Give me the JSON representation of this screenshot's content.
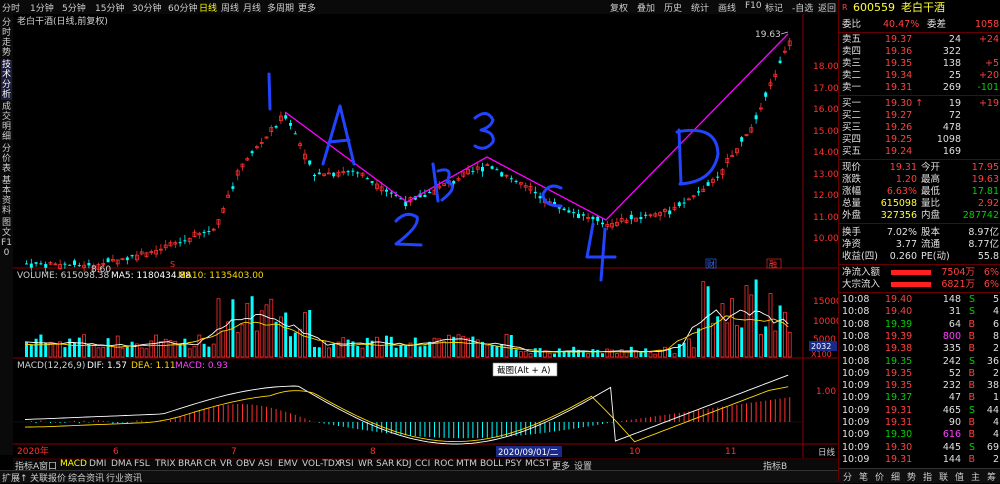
{
  "toolbar": {
    "periods": [
      "分时",
      "1分钟",
      "5分钟",
      "15分钟",
      "30分钟",
      "60分钟",
      "日线",
      "周线",
      "月线",
      "多周期",
      "更多"
    ],
    "active_period": "日线",
    "right_buttons": [
      "复权",
      "叠加",
      "历史",
      "统计",
      "画线",
      "F10",
      "标记",
      "-自选",
      "返回"
    ]
  },
  "left_tabs": [
    "分时走势",
    "技术分析",
    "成交明细",
    "分价表",
    "基本资料",
    "图文F10"
  ],
  "left_tabs_active": "技术分析",
  "chart": {
    "title": "老白干酒(日线,前复权)",
    "price_labels": [
      "18.00",
      "17.00",
      "16.00",
      "15.00",
      "14.00",
      "13.00",
      "12.00",
      "11.00",
      "10.00"
    ],
    "high_label": "19.63",
    "low_label": "8.60",
    "annotations": [
      "1",
      "A",
      "2",
      "B",
      "3",
      "C",
      "4",
      "D"
    ],
    "tags": [
      "财",
      "融"
    ]
  },
  "volume": {
    "header": "VOLUME: 615098.38",
    "ma5": "MA5: 1180434.88",
    "ma10": "MA10: 1135403.00",
    "axis": [
      "15000",
      "10000",
      "5000"
    ],
    "unit": "X100",
    "last_value": "2032"
  },
  "macd": {
    "header": "MACD(12,26,9)",
    "dif": "DIF: 1.57",
    "dea": "DEA: 1.11",
    "macd": "MACD: 0.93",
    "axis": "1.00",
    "tooltip": "截图(Alt + A)"
  },
  "dates": {
    "labels": [
      "2020年",
      "6",
      "7",
      "8",
      "2020/09/01/二",
      "10",
      "11"
    ],
    "cycle": "日线"
  },
  "indicator_tabs": [
    "指标A",
    "窗口",
    "MACD",
    "DMI",
    "DMA",
    "FSL",
    "TRIX",
    "BRAR",
    "CR",
    "VR",
    "OBV",
    "ASI",
    "EMV",
    "VOL-TDX",
    "RSI",
    "WR",
    "SAR",
    "KDJ",
    "CCI",
    "ROC",
    "MTM",
    "BOLL",
    "PSY",
    "MCST",
    "更多",
    "设置"
  ],
  "indicator_active": "MACD",
  "indicator_b": "指标B",
  "bottom_tabs": [
    "扩展↑",
    "关联报价",
    "综合资讯",
    "行业资讯"
  ],
  "quote": {
    "code": "600559",
    "name": "老白干酒",
    "webi": {
      "label": "委比",
      "value": "40.47%",
      "label2": "委差",
      "value2": "1058"
    },
    "asks": [
      {
        "label": "卖五",
        "price": "19.37",
        "vol": "24",
        "chg": "+24"
      },
      {
        "label": "卖四",
        "price": "19.36",
        "vol": "322",
        "chg": ""
      },
      {
        "label": "卖三",
        "price": "19.35",
        "vol": "138",
        "chg": "+5"
      },
      {
        "label": "卖二",
        "price": "19.34",
        "vol": "25",
        "chg": "+20"
      },
      {
        "label": "卖一",
        "price": "19.31",
        "vol": "269",
        "chg": "-101"
      }
    ],
    "bids": [
      {
        "label": "买一",
        "price": "19.30",
        "vol": "19",
        "chg": "+19"
      },
      {
        "label": "买二",
        "price": "19.27",
        "vol": "72",
        "chg": ""
      },
      {
        "label": "买三",
        "price": "19.26",
        "vol": "478",
        "chg": ""
      },
      {
        "label": "买四",
        "price": "19.25",
        "vol": "1098",
        "chg": ""
      },
      {
        "label": "买五",
        "price": "19.24",
        "vol": "169",
        "chg": ""
      }
    ],
    "stats": [
      {
        "l1": "现价",
        "v1": "19.31",
        "l2": "今开",
        "v2": "17.95"
      },
      {
        "l1": "涨跌",
        "v1": "1.20",
        "l2": "最高",
        "v2": "19.63"
      },
      {
        "l1": "涨幅",
        "v1": "6.63%",
        "l2": "最低",
        "v2": "17.81"
      },
      {
        "l1": "总量",
        "v1": "615098",
        "l2": "量比",
        "v2": "2.92"
      },
      {
        "l1": "外盘",
        "v1": "327356",
        "l2": "内盘",
        "v2": "287742"
      }
    ],
    "stats2": [
      {
        "l1": "换手",
        "v1": "7.02%",
        "l2": "股本",
        "v2": "8.97亿"
      },
      {
        "l1": "净资",
        "v1": "3.77",
        "l2": "流通",
        "v2": "8.77亿"
      },
      {
        "l1": "收益(四)",
        "v1": "0.260",
        "l2": "PE(动)",
        "v2": "55.8"
      }
    ],
    "flows": [
      {
        "label": "净流入额",
        "value": "7504万",
        "pct": "6%"
      },
      {
        "label": "大宗流入",
        "value": "6821万",
        "pct": "6%"
      }
    ],
    "ticks": [
      {
        "t": "10:08",
        "p": "19.40",
        "v": "148",
        "s": "S",
        "n": "5"
      },
      {
        "t": "10:08",
        "p": "19.40",
        "v": "31",
        "s": "S",
        "n": "4"
      },
      {
        "t": "10:08",
        "p": "19.39",
        "v": "64",
        "s": "B",
        "n": "6"
      },
      {
        "t": "10:08",
        "p": "19.39",
        "v": "800",
        "s": "B",
        "n": "8"
      },
      {
        "t": "10:08",
        "p": "19.38",
        "v": "335",
        "s": "B",
        "n": "2"
      },
      {
        "t": "10:08",
        "p": "19.35",
        "v": "242",
        "s": "S",
        "n": "36"
      },
      {
        "t": "10:09",
        "p": "19.35",
        "v": "52",
        "s": "B",
        "n": "2"
      },
      {
        "t": "10:09",
        "p": "19.35",
        "v": "232",
        "s": "B",
        "n": "38"
      },
      {
        "t": "10:09",
        "p": "19.37",
        "v": "47",
        "s": "B",
        "n": "1"
      },
      {
        "t": "10:09",
        "p": "19.31",
        "v": "465",
        "s": "S",
        "n": "44"
      },
      {
        "t": "10:09",
        "p": "19.31",
        "v": "90",
        "s": "B",
        "n": "4"
      },
      {
        "t": "10:09",
        "p": "19.30",
        "v": "616",
        "s": "B",
        "n": "4"
      },
      {
        "t": "10:09",
        "p": "19.30",
        "v": "445",
        "s": "S",
        "n": "69"
      },
      {
        "t": "10:09",
        "p": "19.31",
        "v": "144",
        "s": "B",
        "n": "2"
      }
    ],
    "bottom_icons": [
      "分",
      "笔",
      "价",
      "细",
      "势",
      "指",
      "联",
      "值",
      "主",
      "筹"
    ]
  },
  "colors": {
    "up": "#ff3030",
    "down": "#00ffff",
    "annot": "#2244ff",
    "trend": "#ff00ff",
    "ma5": "#ffffff",
    "ma10": "#ffd700"
  }
}
